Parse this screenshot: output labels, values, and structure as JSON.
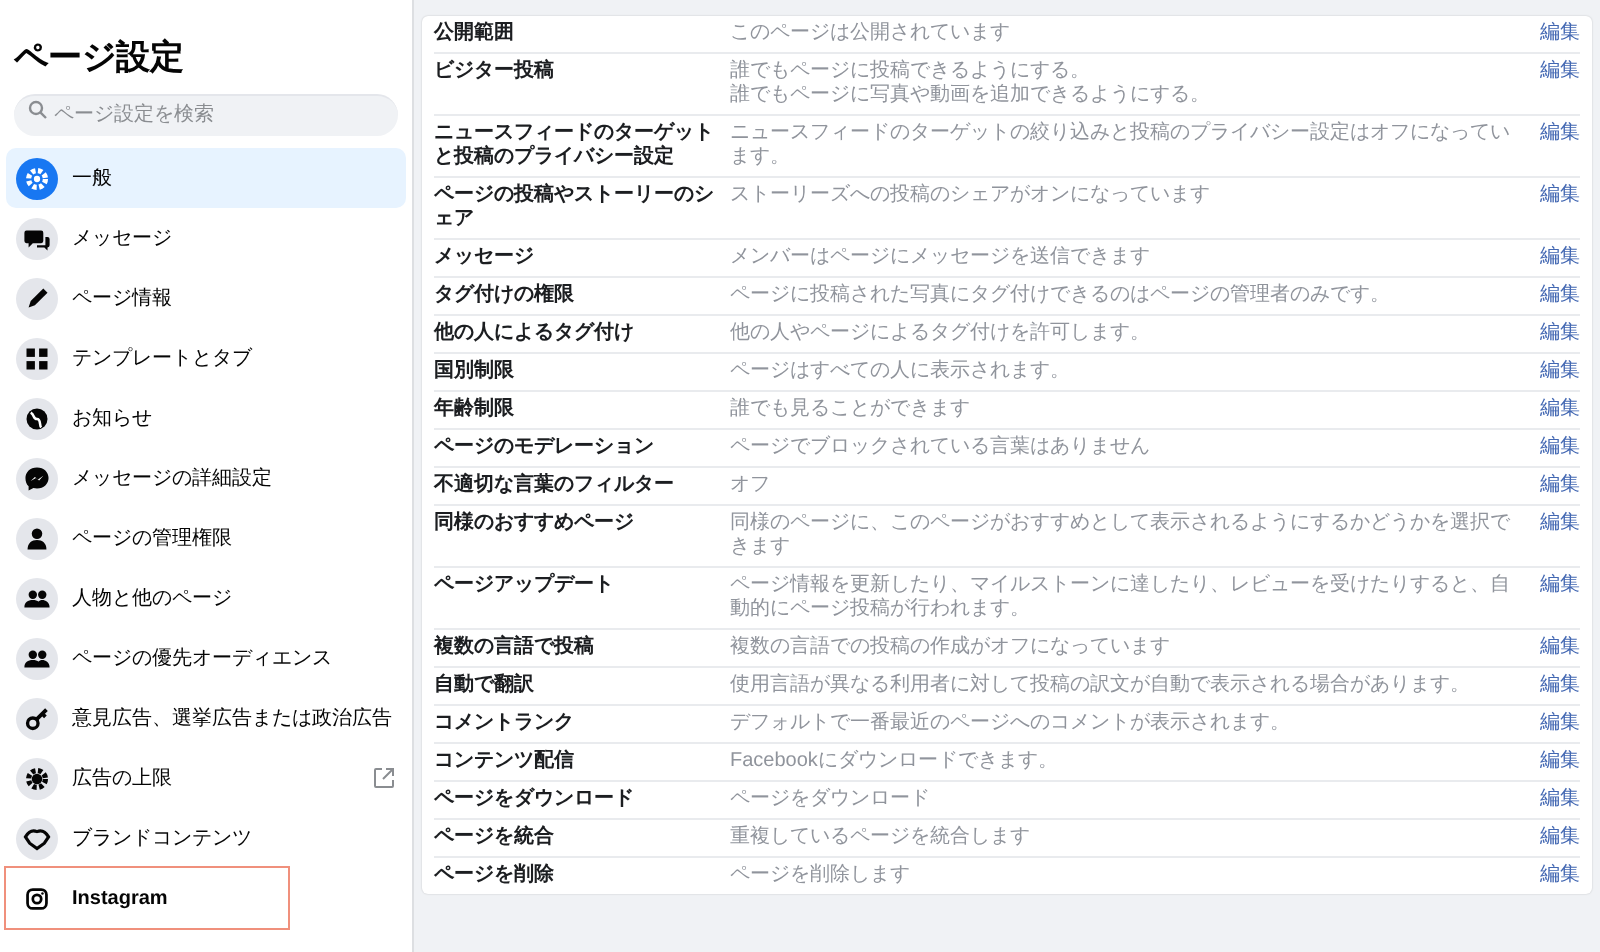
{
  "sidebar": {
    "title": "ページ設定",
    "search": {
      "placeholder": "ページ設定を検索"
    },
    "items": [
      {
        "label": "一般",
        "selected": true,
        "outlined": false,
        "external": false
      },
      {
        "label": "メッセージ",
        "selected": false,
        "outlined": false,
        "external": false
      },
      {
        "label": "ページ情報",
        "selected": false,
        "outlined": false,
        "external": false
      },
      {
        "label": "テンプレートとタブ",
        "selected": false,
        "outlined": false,
        "external": false
      },
      {
        "label": "お知らせ",
        "selected": false,
        "outlined": false,
        "external": false
      },
      {
        "label": "メッセージの詳細設定",
        "selected": false,
        "outlined": false,
        "external": false
      },
      {
        "label": "ページの管理権限",
        "selected": false,
        "outlined": false,
        "external": false
      },
      {
        "label": "人物と他のページ",
        "selected": false,
        "outlined": false,
        "external": false
      },
      {
        "label": "ページの優先オーディエンス",
        "selected": false,
        "outlined": false,
        "external": false
      },
      {
        "label": "意見広告、選挙広告または政治広告",
        "selected": false,
        "outlined": false,
        "external": false
      },
      {
        "label": "広告の上限",
        "selected": false,
        "outlined": false,
        "external": true
      },
      {
        "label": "ブランドコンテンツ",
        "selected": false,
        "outlined": false,
        "external": false
      },
      {
        "label": "Instagram",
        "selected": false,
        "outlined": true,
        "external": false
      }
    ]
  },
  "settings": {
    "rows": [
      {
        "label": "公開範囲",
        "values": [
          "このページは公開されています"
        ],
        "action": "編集"
      },
      {
        "label": "ビジター投稿",
        "values": [
          "誰でもページに投稿できるようにする。",
          "誰でもページに写真や動画を追加できるようにする。"
        ],
        "action": "編集"
      },
      {
        "label": "ニュースフィードのターゲットと投稿のプライバシー設定",
        "values": [
          "ニュースフィードのターゲットの絞り込みと投稿のプライバシー設定はオフになっています。"
        ],
        "action": "編集"
      },
      {
        "label": "ページの投稿やストーリーのシェア",
        "values": [
          "ストーリーズへの投稿のシェアがオンになっています"
        ],
        "action": "編集"
      },
      {
        "label": "メッセージ",
        "values": [
          "メンバーはページにメッセージを送信できます"
        ],
        "action": "編集"
      },
      {
        "label": "タグ付けの権限",
        "values": [
          "ページに投稿された写真にタグ付けできるのはページの管理者のみです。"
        ],
        "action": "編集"
      },
      {
        "label": "他の人によるタグ付け",
        "values": [
          "他の人やページによるタグ付けを許可します。"
        ],
        "action": "編集"
      },
      {
        "label": "国別制限",
        "values": [
          "ページはすべての人に表示されます。"
        ],
        "action": "編集"
      },
      {
        "label": "年齢制限",
        "values": [
          "誰でも見ることができます"
        ],
        "action": "編集"
      },
      {
        "label": "ページのモデレーション",
        "values": [
          "ページでブロックされている言葉はありません"
        ],
        "action": "編集"
      },
      {
        "label": "不適切な言葉のフィルター",
        "values": [
          "オフ"
        ],
        "action": "編集"
      },
      {
        "label": "同様のおすすめページ",
        "values": [
          "同様のページに、このページがおすすめとして表示されるようにするかどうかを選択できます"
        ],
        "action": "編集"
      },
      {
        "label": "ページアップデート",
        "values": [
          "ページ情報を更新したり、マイルストーンに達したり、レビューを受けたりすると、自動的にページ投稿が行われます。"
        ],
        "action": "編集"
      },
      {
        "label": "複数の言語で投稿",
        "values": [
          "複数の言語での投稿の作成がオフになっています"
        ],
        "action": "編集"
      },
      {
        "label": "自動で翻訳",
        "values": [
          "使用言語が異なる利用者に対して投稿の訳文が自動で表示される場合があります。"
        ],
        "action": "編集"
      },
      {
        "label": "コメントランク",
        "values": [
          "デフォルトで一番最近のページへのコメントが表示されます。"
        ],
        "action": "編集"
      },
      {
        "label": "コンテンツ配信",
        "values": [
          "Facebookにダウンロードできます。"
        ],
        "action": "編集"
      },
      {
        "label": "ページをダウンロード",
        "values": [
          "ページをダウンロード"
        ],
        "action": "編集"
      },
      {
        "label": "ページを統合",
        "values": [
          "重複しているページを統合します"
        ],
        "action": "編集"
      },
      {
        "label": "ページを削除",
        "values": [
          "ページを削除します"
        ],
        "action": "編集"
      }
    ]
  }
}
